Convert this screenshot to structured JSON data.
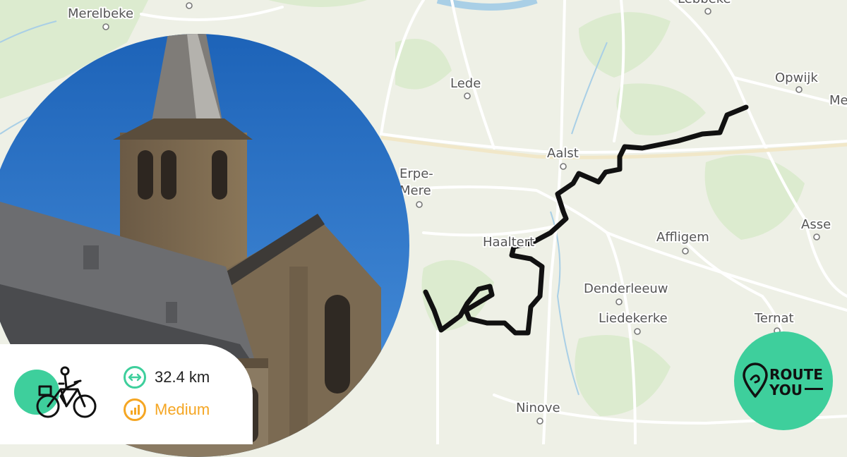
{
  "map": {
    "places": [
      {
        "name": "Merelbeke"
      },
      {
        "name": "Lebbeke"
      },
      {
        "name": "Lede"
      },
      {
        "name": "Opwijk"
      },
      {
        "name": "Me"
      },
      {
        "name": "Aalst"
      },
      {
        "name": "Erpe-"
      },
      {
        "name": "Mere"
      },
      {
        "name": "Asse"
      },
      {
        "name": "Affligem"
      },
      {
        "name": "Haaltert"
      },
      {
        "name": "Denderleeuw"
      },
      {
        "name": "Liedekerke"
      },
      {
        "name": "Ternat"
      },
      {
        "name": "Ninove"
      }
    ],
    "route_color": "#111111"
  },
  "stats": {
    "activity_icon": "bicycle-rider-icon",
    "distance": "32.4 km",
    "distance_icon": "double-arrow-icon",
    "difficulty": "Medium",
    "difficulty_icon": "signal-bars-icon",
    "accent_color": "#3ecf9c",
    "difficulty_color": "#f5a623"
  },
  "logo": {
    "line1": "ROUTE",
    "line2": "YOU",
    "color": "#3ecf9c"
  }
}
